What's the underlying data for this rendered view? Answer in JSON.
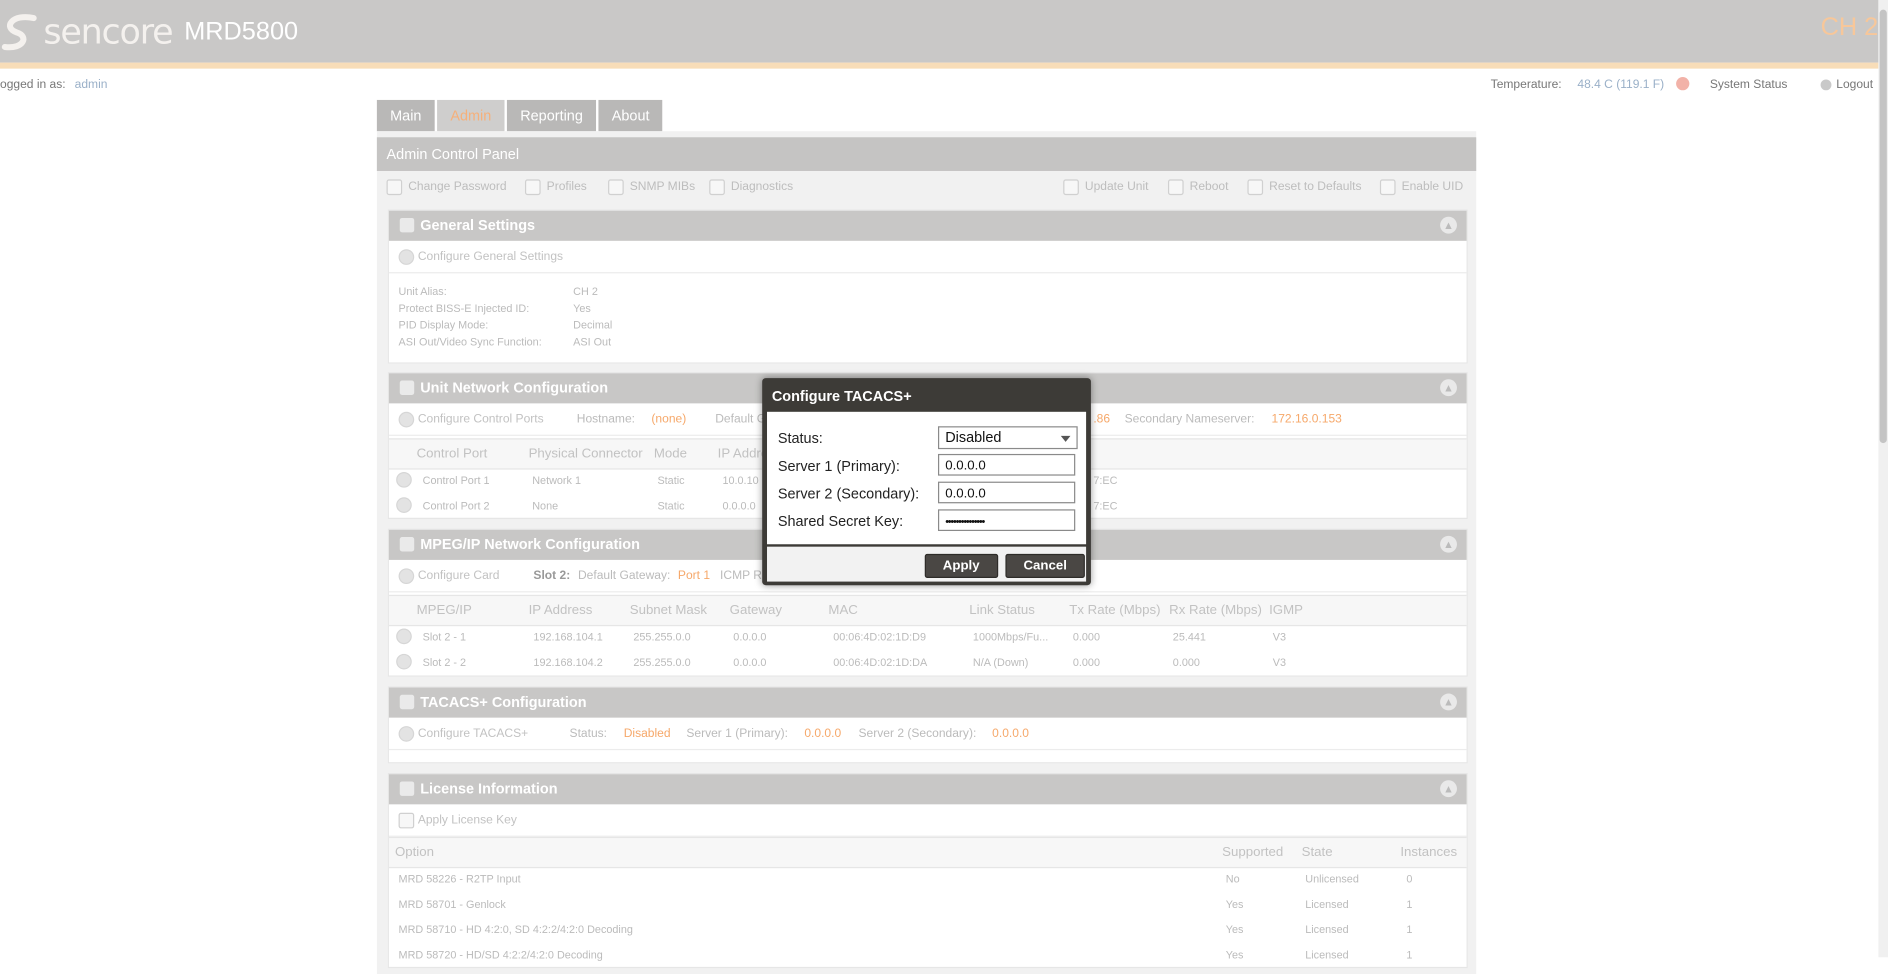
{
  "header": {
    "logo_text": "sencore",
    "product": "MRD5800",
    "channel": "CH 2"
  },
  "topbar": {
    "logged_in_label": "ogged in as:",
    "user": "admin",
    "temperature_label": "Temperature:",
    "temperature_value": "48.4 C (119.1 F)",
    "system_status": "System Status",
    "logout": "Logout"
  },
  "tabs": [
    "Main",
    "Admin",
    "Reporting",
    "About"
  ],
  "panel_title": "Admin Control Panel",
  "toolbar": {
    "change_password": "Change Password",
    "profiles": "Profiles",
    "snmp_mibs": "SNMP MIBs",
    "diagnostics": "Diagnostics",
    "update_unit": "Update Unit",
    "reboot": "Reboot",
    "reset_defaults": "Reset to Defaults",
    "enable_uid": "Enable UID"
  },
  "general": {
    "title": "General Settings",
    "configure": "Configure General Settings",
    "unit_alias_label": "Unit Alias:",
    "unit_alias": "CH 2",
    "protect_label": "Protect BISS-E Injected ID:",
    "protect": "Yes",
    "pid_label": "PID Display Mode:",
    "pid": "Decimal",
    "asi_label": "ASI Out/Video Sync Function:",
    "asi": "ASI Out"
  },
  "network": {
    "title": "Unit Network Configuration",
    "configure": "Configure Control Ports",
    "hostname_label": "Hostname:",
    "hostname": "(none)",
    "default_label": "Default G",
    "default_tail": ".86",
    "secondary_ns_label": "Secondary Nameserver:",
    "secondary_ns": "172.16.0.153",
    "headers": [
      "Control Port",
      "Physical Connector",
      "Mode",
      "IP Addre"
    ],
    "rows": [
      {
        "port": "Control Port 1",
        "connector": "Network 1",
        "mode": "Static",
        "ip": "10.0.10",
        "mac_tail": "7:EC"
      },
      {
        "port": "Control Port 2",
        "connector": "None",
        "mode": "Static",
        "ip": "0.0.0.0",
        "mac_tail": "7:EC"
      }
    ]
  },
  "mpeg": {
    "title": "MPEG/IP Network Configuration",
    "configure": "Configure Card",
    "slot_label": "Slot 2:",
    "gateway_label": "Default Gateway:",
    "gateway": "Port 1",
    "icmp": "ICMP R",
    "headers": [
      "MPEG/IP",
      "IP Address",
      "Subnet Mask",
      "Gateway",
      "MAC",
      "Link Status",
      "Tx Rate (Mbps)",
      "Rx Rate (Mbps)",
      "IGMP"
    ],
    "rows": [
      [
        "Slot 2 - 1",
        "192.168.104.1",
        "255.255.0.0",
        "0.0.0.0",
        "00:06:4D:02:1D:D9",
        "1000Mbps/Fu...",
        "0.000",
        "25.441",
        "V3"
      ],
      [
        "Slot 2 - 2",
        "192.168.104.2",
        "255.255.0.0",
        "0.0.0.0",
        "00:06:4D:02:1D:DA",
        "N/A (Down)",
        "0.000",
        "0.000",
        "V3"
      ]
    ]
  },
  "tacacs_section": {
    "title": "TACACS+ Configuration",
    "configure": "Configure TACACS+",
    "status_label": "Status:",
    "status": "Disabled",
    "s1_label": "Server 1 (Primary):",
    "s1": "0.0.0.0",
    "s2_label": "Server 2 (Secondary):",
    "s2": "0.0.0.0"
  },
  "license": {
    "title": "License Information",
    "apply": "Apply License Key",
    "headers": [
      "Option",
      "Supported",
      "State",
      "Instances"
    ],
    "rows": [
      [
        "MRD 58226 - R2TP Input",
        "No",
        "Unlicensed",
        "0"
      ],
      [
        "MRD 58701 - Genlock",
        "Yes",
        "Licensed",
        "1"
      ],
      [
        "MRD 58710 - HD 4:2:0, SD 4:2:2/4:2:0 Decoding",
        "Yes",
        "Licensed",
        "1"
      ],
      [
        "MRD 58720 - HD/SD 4:2:2/4:2:0 Decoding",
        "Yes",
        "Licensed",
        "1"
      ]
    ]
  },
  "modal": {
    "title": "Configure TACACS+",
    "status_label": "Status:",
    "status_value": "Disabled",
    "server1_label": "Server 1 (Primary):",
    "server1_value": "0.0.0.0",
    "server2_label": "Server 2 (Secondary):",
    "server2_value": "0.0.0.0",
    "secret_label": "Shared Secret Key:",
    "secret_value": "•••••••••••••••",
    "apply": "Apply",
    "cancel": "Cancel"
  }
}
